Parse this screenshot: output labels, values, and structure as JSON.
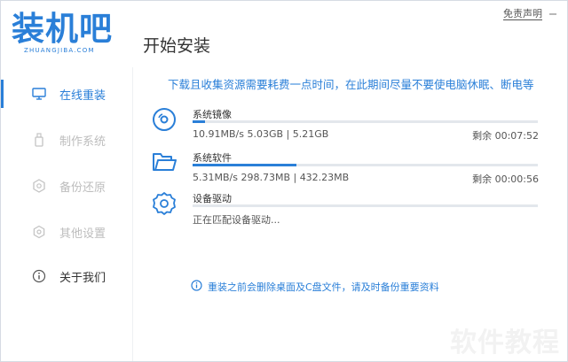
{
  "app": {
    "logo_text": "装机吧",
    "logo_sub": "ZHUANGJIBA.COM",
    "title": "开始安装",
    "disclaimer": "免责声明",
    "brand_color": "#2a7fd8"
  },
  "sidebar": {
    "items": [
      {
        "label": "在线重装",
        "icon": "monitor-icon",
        "active": true
      },
      {
        "label": "制作系统",
        "icon": "usb-icon",
        "active": false
      },
      {
        "label": "备份还原",
        "icon": "backup-icon",
        "active": false
      },
      {
        "label": "其他设置",
        "icon": "settings-icon",
        "active": false
      },
      {
        "label": "关于我们",
        "icon": "info-icon",
        "active": false
      }
    ]
  },
  "main": {
    "notice": "下载且收集资源需要耗费一点时间，在此期间尽量不要使电脑休眠、断电等",
    "tasks": [
      {
        "name": "系统镜像",
        "icon": "disc-icon",
        "stats": "10.91MB/s 5.03GB | 5.21GB",
        "remaining": "剩余 00:07:52",
        "progress": 0.035
      },
      {
        "name": "系统软件",
        "icon": "folder-icon",
        "stats": "5.31MB/s 298.73MB | 432.23MB",
        "remaining": "剩余 00:00:56",
        "progress": 0.3
      },
      {
        "name": "设备驱动",
        "icon": "gear-icon",
        "stats": "正在匹配设备驱动...",
        "remaining": "",
        "progress": 0
      }
    ],
    "warning": "重装之前会删除桌面及C盘文件，请及时备份重要资料"
  },
  "watermark": "软件教程"
}
